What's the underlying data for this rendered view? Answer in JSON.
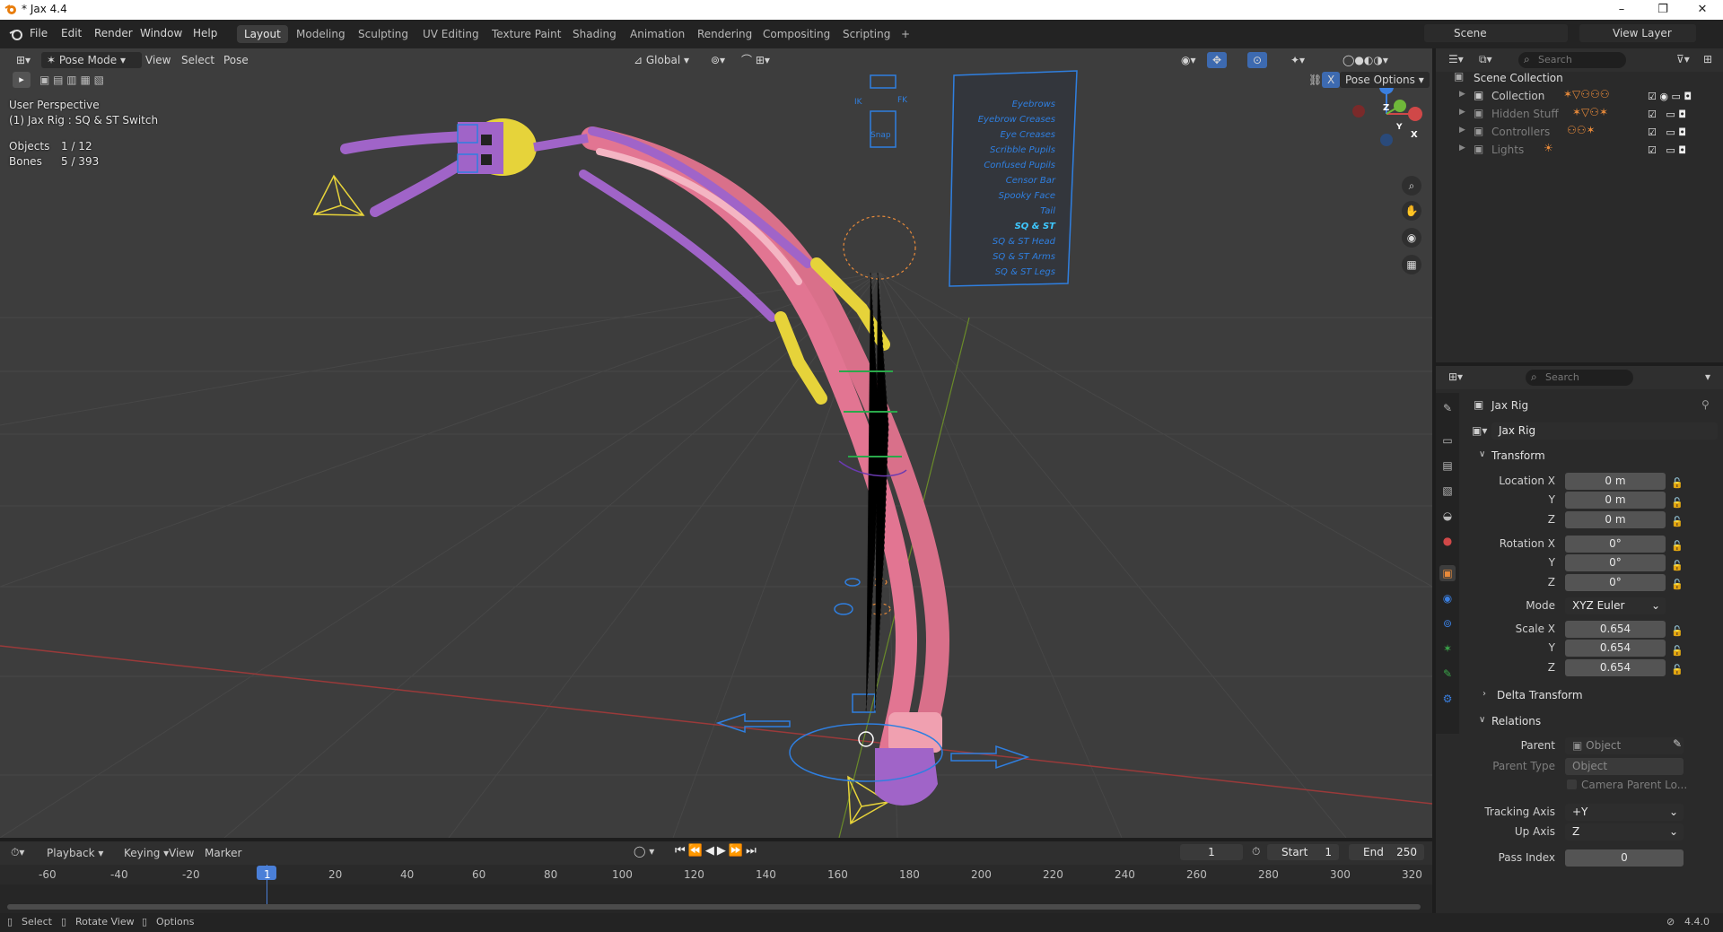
{
  "window": {
    "title": "* Jax 4.4",
    "minimize": "–",
    "maximize": "❐",
    "close": "✕"
  },
  "menus": [
    "File",
    "Edit",
    "Render",
    "Window",
    "Help"
  ],
  "workspaces": [
    "Layout",
    "Modeling",
    "Sculpting",
    "UV Editing",
    "Texture Paint",
    "Shading",
    "Animation",
    "Rendering",
    "Compositing",
    "Scripting"
  ],
  "workspace_add": "+",
  "scene": {
    "label": "Scene",
    "view_layer": "View Layer"
  },
  "viewport_header": {
    "mode": "Pose Mode",
    "menus": [
      "View",
      "Select",
      "Pose"
    ],
    "orientation": "Global",
    "pose_options": "Pose Options"
  },
  "overlay": {
    "perspective": "User Perspective",
    "active": "(1) Jax Rig : SQ & ST Switch",
    "objects_label": "Objects",
    "objects_value": "1 / 12",
    "bones_label": "Bones",
    "bones_value": "5 / 393"
  },
  "controller_panel": {
    "items": [
      "Eyebrows",
      "Eyebrow Creases",
      "Eye Creases",
      "Scribble Pupils",
      "Confused Pupils",
      "Censor Bar",
      "Spooky Face",
      "Tail",
      "SQ & ST",
      "SQ & ST Head",
      "SQ & ST Arms",
      "SQ & ST Legs"
    ],
    "highlight": "SQ & ST",
    "ik": "IK",
    "fk": "FK",
    "snap": "Snap"
  },
  "gizmo": {
    "x": "X",
    "y": "Y",
    "z": "Z"
  },
  "outliner": {
    "search_placeholder": "Search",
    "root": "Scene Collection",
    "items": [
      "Collection",
      "Hidden Stuff",
      "Controllers",
      "Lights"
    ]
  },
  "properties": {
    "search_placeholder": "Search",
    "object_name": "Jax Rig",
    "object_field": "Jax Rig",
    "transform_header": "Transform",
    "location_label": "Location X",
    "location": [
      "0 m",
      "0 m",
      "0 m"
    ],
    "rotation_label": "Rotation X",
    "rotation": [
      "0°",
      "0°",
      "0°"
    ],
    "axis_y": "Y",
    "axis_z": "Z",
    "mode_label": "Mode",
    "mode": "XYZ Euler",
    "scale_label": "Scale X",
    "scale": [
      "0.654",
      "0.654",
      "0.654"
    ],
    "delta_header": "Delta Transform",
    "relations_header": "Relations",
    "parent_label": "Parent",
    "parent_placeholder": "Object",
    "parent_type_label": "Parent Type",
    "parent_type": "Object",
    "camera_parent": "Camera Parent Lo...",
    "tracking_label": "Tracking Axis",
    "tracking": "+Y",
    "up_label": "Up Axis",
    "up": "Z",
    "pass_label": "Pass Index",
    "pass": "0"
  },
  "timeline": {
    "menus": [
      "Playback",
      "Keying",
      "View",
      "Marker"
    ],
    "current_frame": "1",
    "start_label": "Start",
    "start": "1",
    "end_label": "End",
    "end": "250",
    "ticks": [
      "-60",
      "-40",
      "-20",
      "1",
      "20",
      "40",
      "60",
      "80",
      "100",
      "120",
      "140",
      "160",
      "180",
      "200",
      "220",
      "240",
      "260",
      "280",
      "300",
      "320"
    ]
  },
  "status": {
    "select": "Select",
    "rotate": "Rotate View",
    "options": "Options",
    "version": "4.4.0"
  }
}
